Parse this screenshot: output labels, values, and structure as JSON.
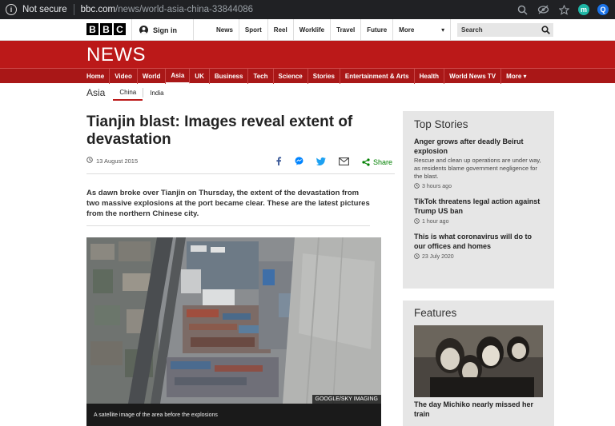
{
  "browser": {
    "security_label": "Not secure",
    "url_domain": "bbc.com",
    "url_path": "/news/world-asia-china-33844086"
  },
  "header": {
    "logo_letters": [
      "B",
      "B",
      "C"
    ],
    "signin_label": "Sign in",
    "nav": [
      "News",
      "Sport",
      "Reel",
      "Worklife",
      "Travel",
      "Future"
    ],
    "more_label": "More",
    "search_placeholder": "Search"
  },
  "banner": {
    "title": "NEWS"
  },
  "section_nav": {
    "items": [
      "Home",
      "Video",
      "World",
      "Asia",
      "UK",
      "Business",
      "Tech",
      "Science",
      "Stories",
      "Entertainment & Arts",
      "Health",
      "World News TV",
      "More ▾"
    ],
    "active": "Asia"
  },
  "sub_nav": {
    "title": "Asia",
    "items": [
      "China",
      "India"
    ],
    "active": "China"
  },
  "article": {
    "headline": "Tianjin blast: Images reveal extent of devastation",
    "date": "13 August 2015",
    "share_label": "Share",
    "intro": "As dawn broke over Tianjin on Thursday, the extent of the devastation from two massive explosions at the port became clear. These are the latest pictures from the northern Chinese city.",
    "image_credit": "GOOGLE/SKY IMAGING",
    "image_caption": "A satellite image of the area before the explosions"
  },
  "top_stories": {
    "title": "Top Stories",
    "items": [
      {
        "headline": "Anger grows after deadly Beirut explosion",
        "summary": "Rescue and clean up operations are under way, as residents blame government negligence for the blast.",
        "time": "3 hours ago"
      },
      {
        "headline": "TikTok threatens legal action against Trump US ban",
        "time": "1 hour ago"
      },
      {
        "headline": "This is what coronavirus will do to our offices and homes",
        "time": "23 July 2020"
      }
    ]
  },
  "features": {
    "title": "Features",
    "headline": "The day Michiko nearly missed her train"
  },
  "colors": {
    "bbc_red": "#bb1919",
    "share_green": "#008000",
    "sidebar_bg": "#e6e6e6"
  }
}
